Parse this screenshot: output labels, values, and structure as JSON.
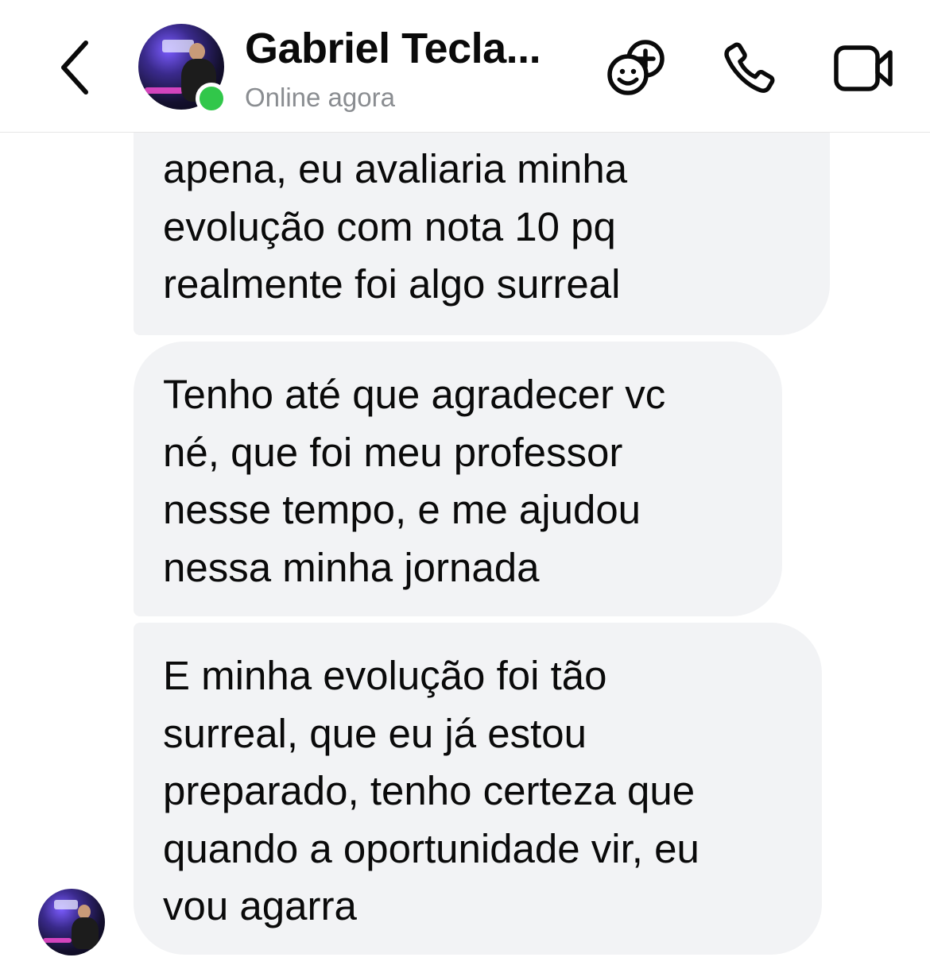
{
  "header": {
    "contact_name": "Gabriel Tecla...",
    "status": "Online agora",
    "status_color": "#31c74a",
    "icons": [
      "chevron-left-icon",
      "game-controller-add-icon",
      "phone-icon",
      "video-camera-icon"
    ]
  },
  "messages": [
    {
      "sender": "contact",
      "lines": [
        "apena, eu avaliaria minha",
        "evolução com nota 10 pq",
        "realmente foi algo surreal"
      ]
    },
    {
      "sender": "contact",
      "lines": [
        "Tenho até que agradecer vc",
        "né, que foi meu professor",
        "nesse tempo, e me ajudou",
        "nessa minha jornada"
      ]
    },
    {
      "sender": "contact",
      "lines": [
        "E minha evolução foi tão",
        "surreal, que eu já estou",
        "preparado, tenho certeza que",
        "quando a oportunidade vir, eu",
        "vou agarra"
      ]
    }
  ],
  "colors": {
    "bubble_background": "#f2f3f5",
    "text": "#0a0a0a",
    "status_text": "#8a8d91"
  }
}
